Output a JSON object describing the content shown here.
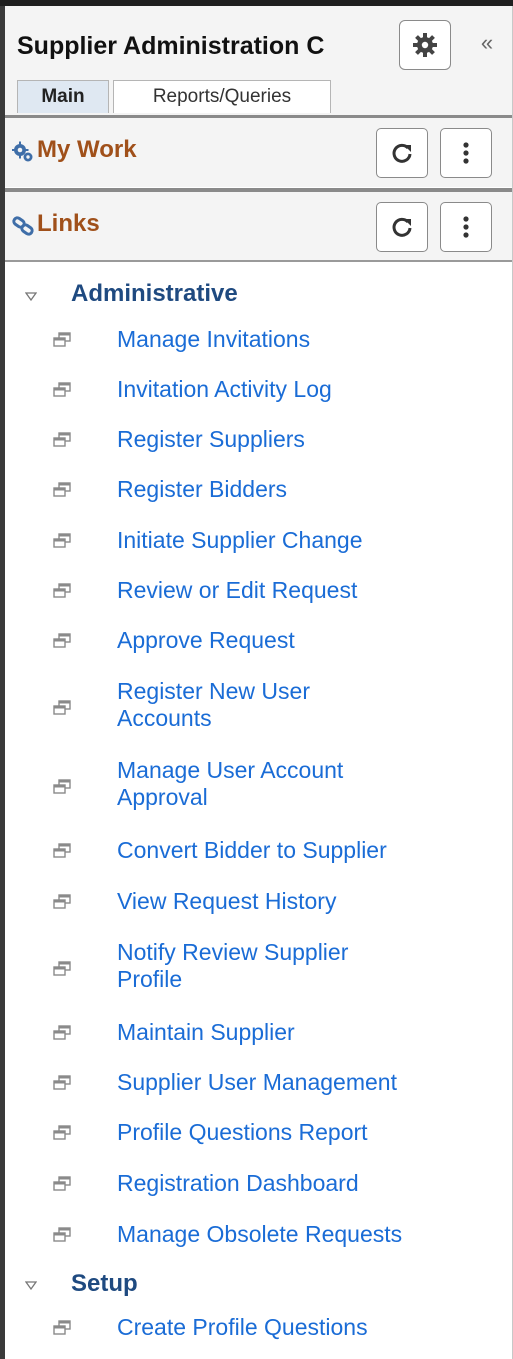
{
  "header": {
    "title": "Supplier Administration C",
    "tabs": [
      {
        "label": "Main",
        "active": true
      },
      {
        "label": "Reports/Queries",
        "active": false
      }
    ],
    "settings_icon": "gear-icon",
    "collapse_label": "«"
  },
  "sections": [
    {
      "title": "My Work",
      "icon": "gears-icon"
    },
    {
      "title": "Links",
      "icon": "links-icon"
    }
  ],
  "groups": [
    {
      "label": "Administrative",
      "items": [
        "Manage Invitations",
        "Invitation Activity Log",
        "Register Suppliers",
        "Register Bidders",
        "Initiate Supplier Change",
        "Review or Edit Request",
        "Approve Request",
        "Register New User Accounts",
        "Manage User Account Approval",
        "Convert Bidder to Supplier",
        "View Request History",
        "Notify Review Supplier Profile",
        "Maintain Supplier",
        "Supplier User Management",
        "Profile Questions Report",
        "Registration Dashboard",
        "Manage Obsolete Requests"
      ]
    },
    {
      "label": "Setup",
      "items": [
        "Create Profile Questions"
      ]
    }
  ],
  "colors": {
    "section_title": "#a0501a",
    "group_label": "#1f4a80",
    "link": "#1a6cd6",
    "panel_bg": "#f4f4f4"
  }
}
